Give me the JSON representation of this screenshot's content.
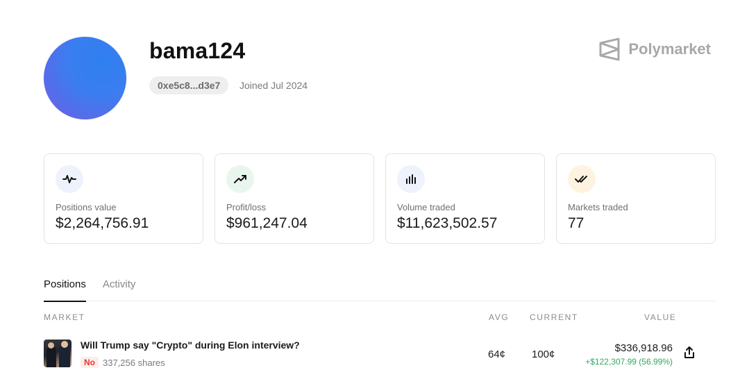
{
  "profile": {
    "username": "bama124",
    "address": "0xe5c8...d3e7",
    "joined": "Joined Jul 2024"
  },
  "brand": {
    "name": "Polymarket"
  },
  "stats": [
    {
      "label": "Positions value",
      "value": "$2,264,756.91",
      "icon": "activity-icon",
      "icon_bg": "#eef2fd"
    },
    {
      "label": "Profit/loss",
      "value": "$961,247.04",
      "icon": "trending-up-icon",
      "icon_bg": "#e9f6ee"
    },
    {
      "label": "Volume traded",
      "value": "$11,623,502.57",
      "icon": "bar-chart-icon",
      "icon_bg": "#eef2fd"
    },
    {
      "label": "Markets traded",
      "value": "77",
      "icon": "double-check-icon",
      "icon_bg": "#fdf3e0"
    }
  ],
  "tabs": [
    {
      "label": "Positions",
      "active": true
    },
    {
      "label": "Activity",
      "active": false
    }
  ],
  "table": {
    "headers": {
      "market": "MARKET",
      "avg": "AVG",
      "current": "CURRENT",
      "value": "VALUE"
    },
    "rows": [
      {
        "title": "Will Trump say \"Crypto\" during Elon interview?",
        "outcome": "No",
        "shares": "337,256 shares",
        "avg": "64¢",
        "current": "100¢",
        "value": "$336,918.96",
        "change": "+$122,307.99 (56.99%)"
      }
    ]
  },
  "colors": {
    "accent_green": "#2fa85c",
    "outcome_no": "#e23b2e",
    "avatar_blue": "#2f7ff0",
    "avatar_purple": "#7b5ae0"
  }
}
